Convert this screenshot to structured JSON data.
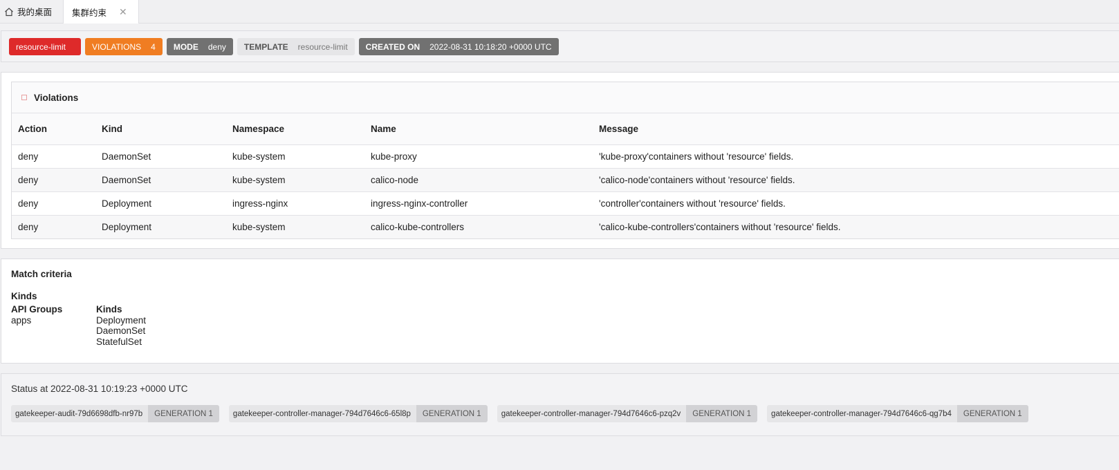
{
  "tabs": [
    {
      "label": "我的桌面",
      "icon": "home-icon"
    },
    {
      "label": "集群约束",
      "icon": "close-icon",
      "close": "✕"
    }
  ],
  "header": {
    "name": "resource-limit",
    "violations_label": "VIOLATIONS",
    "violations_count": "4",
    "mode_label": "MODE",
    "mode_value": "deny",
    "template_label": "TEMPLATE",
    "template_value": "resource-limit",
    "created_label": "CREATED ON",
    "created_value": "2022-08-31 10:18:20 +0000 UTC"
  },
  "violations": {
    "title": "Violations",
    "columns": [
      "Action",
      "Kind",
      "Namespace",
      "Name",
      "Message"
    ],
    "rows": [
      [
        "deny",
        "DaemonSet",
        "kube-system",
        "kube-proxy",
        "'kube-proxy'containers without 'resource' fields."
      ],
      [
        "deny",
        "DaemonSet",
        "kube-system",
        "calico-node",
        "'calico-node'containers without 'resource' fields."
      ],
      [
        "deny",
        "Deployment",
        "ingress-nginx",
        "ingress-nginx-controller",
        "'controller'containers without 'resource' fields."
      ],
      [
        "deny",
        "Deployment",
        "kube-system",
        "calico-kube-controllers",
        "'calico-kube-controllers'containers without 'resource' fields."
      ]
    ]
  },
  "match": {
    "title": "Match criteria",
    "kinds_title": "Kinds",
    "api_groups_label": "API Groups",
    "api_groups": [
      "apps"
    ],
    "kinds_label": "Kinds",
    "kinds": [
      "Deployment",
      "DaemonSet",
      "StatefulSet"
    ]
  },
  "status": {
    "title": "Status at 2022-08-31 10:19:23 +0000 UTC",
    "pods": [
      {
        "name": "gatekeeper-audit-79d6698dfb-nr97b",
        "generation": "GENERATION 1"
      },
      {
        "name": "gatekeeper-controller-manager-794d7646c6-65l8p",
        "generation": "GENERATION 1"
      },
      {
        "name": "gatekeeper-controller-manager-794d7646c6-pzq2v",
        "generation": "GENERATION 1"
      },
      {
        "name": "gatekeeper-controller-manager-794d7646c6-qg7b4",
        "generation": "GENERATION 1"
      }
    ]
  },
  "colors": {
    "name_chip": "#de2a2a",
    "violations_chip": "#f07d22",
    "mode_chip": "#717171",
    "created_chip": "#717171"
  }
}
